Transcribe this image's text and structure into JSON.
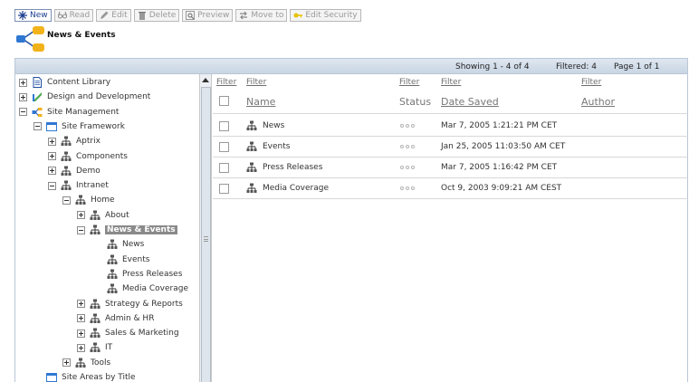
{
  "toolbar": {
    "buttons": [
      {
        "label": "New",
        "icon": "new-star-icon",
        "active": true
      },
      {
        "label": "Read",
        "icon": "read-glasses-icon",
        "active": false
      },
      {
        "label": "Edit",
        "icon": "pencil-icon",
        "active": false
      },
      {
        "label": "Delete",
        "icon": "trash-icon",
        "active": false
      },
      {
        "label": "Preview",
        "icon": "preview-magnifier-icon",
        "active": false
      },
      {
        "label": "Move to",
        "icon": "move-arrows-icon",
        "active": false
      },
      {
        "label": "Edit Security",
        "icon": "key-icon",
        "active": false
      }
    ]
  },
  "heading": {
    "title": "News & Events",
    "icon": "site-area-tree-icon"
  },
  "status_bar": {
    "showing": "Showing 1 - 4 of 4",
    "filtered": "Filtered: 4",
    "page": "Page 1 of 1"
  },
  "tree": {
    "nodes": [
      {
        "label": "Content Library",
        "icon": "document-icon",
        "expander": "plus",
        "level": 0
      },
      {
        "label": "Design and Development",
        "icon": "design-ruler-icon",
        "expander": "plus",
        "level": 0
      },
      {
        "label": "Site Management",
        "icon": "site-management-icon",
        "expander": "minus",
        "level": 0
      },
      {
        "label": "Site Framework",
        "icon": "window-icon",
        "expander": "minus",
        "level": 1
      },
      {
        "label": "Aptrix",
        "icon": "site-area-icon",
        "expander": "plus",
        "level": 2
      },
      {
        "label": "Components",
        "icon": "site-area-icon",
        "expander": "plus",
        "level": 2
      },
      {
        "label": "Demo",
        "icon": "site-area-icon",
        "expander": "plus",
        "level": 2
      },
      {
        "label": "Intranet",
        "icon": "site-area-icon",
        "expander": "minus",
        "level": 2
      },
      {
        "label": "Home",
        "icon": "site-area-icon",
        "expander": "minus",
        "level": 3
      },
      {
        "label": "About",
        "icon": "site-area-icon",
        "expander": "plus",
        "level": 4
      },
      {
        "label": "News & Events",
        "icon": "site-area-icon",
        "expander": "minus",
        "level": 4,
        "selected": true
      },
      {
        "label": "News",
        "icon": "site-area-icon",
        "expander": "none",
        "level": 5
      },
      {
        "label": "Events",
        "icon": "site-area-icon",
        "expander": "none",
        "level": 5
      },
      {
        "label": "Press Releases",
        "icon": "site-area-icon",
        "expander": "none",
        "level": 5
      },
      {
        "label": "Media Coverage",
        "icon": "site-area-icon",
        "expander": "none",
        "level": 5
      },
      {
        "label": "Strategy & Reports",
        "icon": "site-area-icon",
        "expander": "plus",
        "level": 4
      },
      {
        "label": "Admin & HR",
        "icon": "site-area-icon",
        "expander": "plus",
        "level": 4
      },
      {
        "label": "Sales & Marketing",
        "icon": "site-area-icon",
        "expander": "plus",
        "level": 4
      },
      {
        "label": "IT",
        "icon": "site-area-icon",
        "expander": "plus",
        "level": 4
      },
      {
        "label": "Tools",
        "icon": "site-area-icon",
        "expander": "plus",
        "level": 3
      },
      {
        "label": "Site Areas by Title",
        "icon": "window-icon",
        "expander": "none",
        "level": 1
      }
    ]
  },
  "list": {
    "filter_links": [
      "Filter",
      "Filter",
      "Filter",
      "Filter",
      "Filter"
    ],
    "columns": {
      "name": "Name",
      "status": "Status",
      "date_saved": "Date Saved",
      "author": "Author"
    },
    "rows": [
      {
        "name": "News",
        "date": "Mar 7, 2005 1:21:21 PM CET",
        "icon": "site-area-icon"
      },
      {
        "name": "Events",
        "date": "Jan 25, 2005 11:03:50 AM CET",
        "icon": "site-area-icon"
      },
      {
        "name": "Press Releases",
        "date": "Mar 7, 2005 1:16:42 PM CET",
        "icon": "site-area-icon"
      },
      {
        "name": "Media Coverage",
        "date": "Oct 9, 2003 9:09:21 AM CEST",
        "icon": "site-area-icon"
      }
    ]
  },
  "colors": {
    "header_bg": "#c9d5e3",
    "selected_bg": "#8a8a8a",
    "link": "#1a3d8f"
  }
}
